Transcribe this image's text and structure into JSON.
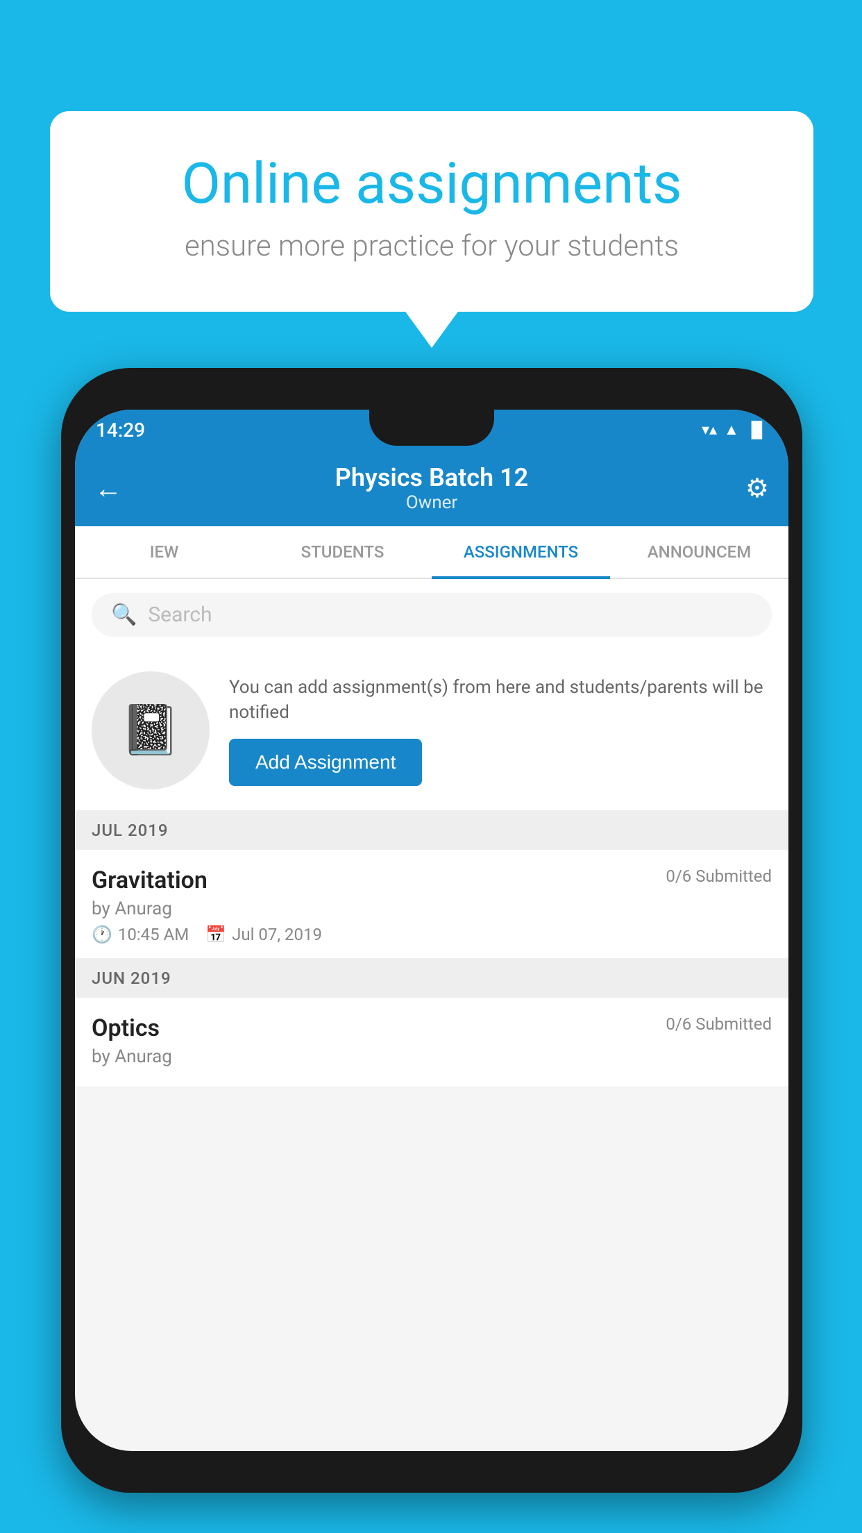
{
  "background": {
    "color": "#1ab8e8"
  },
  "speech_bubble": {
    "title": "Online assignments",
    "subtitle": "ensure more practice for your students"
  },
  "phone": {
    "status_bar": {
      "time": "14:29",
      "wifi": "▼",
      "signal": "▲",
      "battery": "▐"
    },
    "app_bar": {
      "back_label": "←",
      "title": "Physics Batch 12",
      "subtitle": "Owner",
      "settings_label": "⚙"
    },
    "tabs": [
      {
        "label": "IEW",
        "active": false
      },
      {
        "label": "STUDENTS",
        "active": false
      },
      {
        "label": "ASSIGNMENTS",
        "active": true
      },
      {
        "label": "ANNOUNCEM",
        "active": false
      }
    ],
    "search": {
      "placeholder": "Search"
    },
    "empty_state": {
      "description": "You can add assignment(s) from here and students/parents will be notified",
      "button_label": "Add Assignment"
    },
    "sections": [
      {
        "header": "JUL 2019",
        "assignments": [
          {
            "name": "Gravitation",
            "submitted": "0/6 Submitted",
            "author": "by Anurag",
            "time": "10:45 AM",
            "date": "Jul 07, 2019"
          }
        ]
      },
      {
        "header": "JUN 2019",
        "assignments": [
          {
            "name": "Optics",
            "submitted": "0/6 Submitted",
            "author": "by Anurag",
            "time": "",
            "date": ""
          }
        ]
      }
    ]
  }
}
